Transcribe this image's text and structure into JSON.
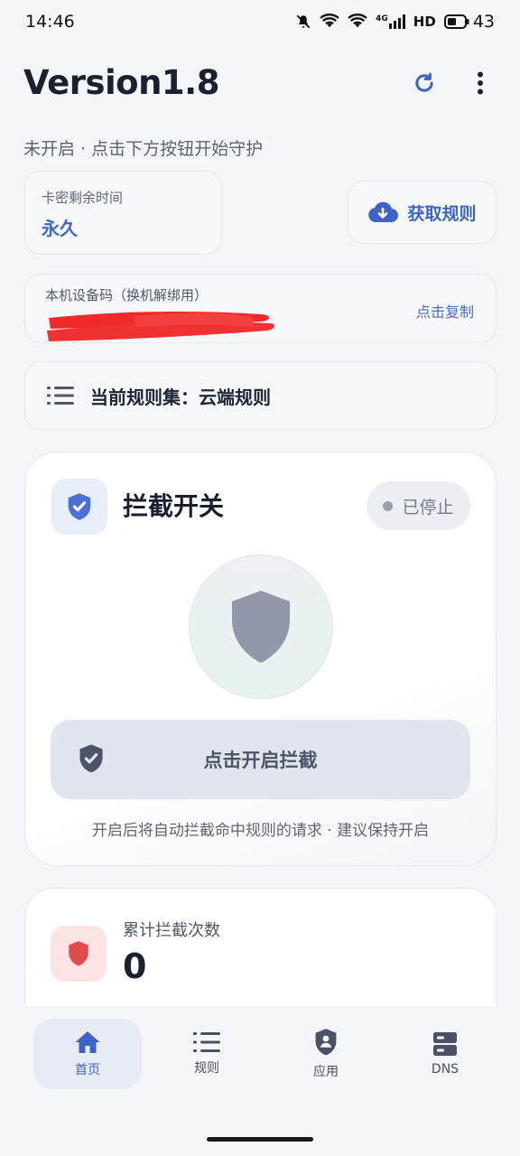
{
  "status_bar": {
    "time": "14:46",
    "network_label": "4G",
    "hd_label": "HD",
    "battery": "43"
  },
  "header": {
    "title": "Version1.8",
    "subtitle": "未开启 · 点击下方按钮开始守护"
  },
  "license": {
    "label": "卡密剩余时间",
    "value": "永久"
  },
  "rules_button": {
    "label": "获取规则"
  },
  "device": {
    "label": "本机设备码（换机解绑用）",
    "copy_label": "点击复制"
  },
  "ruleset": {
    "text": "当前规则集：云端规则"
  },
  "intercept": {
    "title": "拦截开关",
    "status": "已停止",
    "toggle_label": "点击开启拦截",
    "hint": "开启后将自动拦截命中规则的请求 · 建议保持开启"
  },
  "stats": {
    "label": "累计拦截次数",
    "value": "0"
  },
  "nav": [
    {
      "label": "首页",
      "icon": "home-icon",
      "active": true
    },
    {
      "label": "规则",
      "icon": "list-icon",
      "active": false
    },
    {
      "label": "应用",
      "icon": "shield-user-icon",
      "active": false
    },
    {
      "label": "DNS",
      "icon": "server-icon",
      "active": false
    }
  ],
  "colors": {
    "accent": "#3d63c8",
    "danger": "#e24b4b",
    "shield_gray": "#9098a9"
  }
}
